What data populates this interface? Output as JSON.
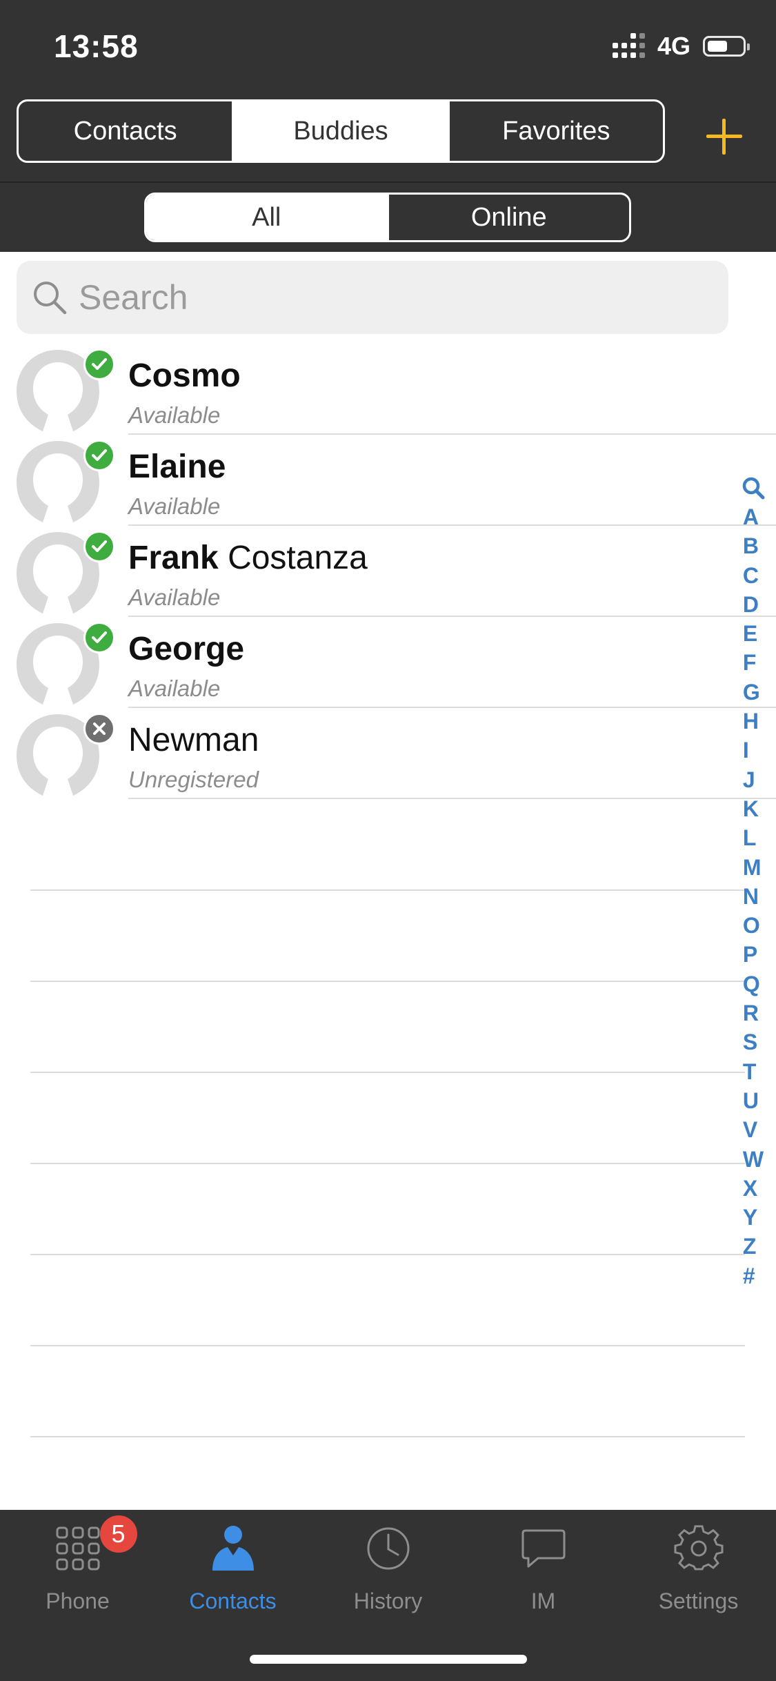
{
  "status_bar": {
    "time": "13:58",
    "network": "4G"
  },
  "top_segments": [
    "Contacts",
    "Buddies",
    "Favorites"
  ],
  "top_segments_active": "Buddies",
  "filter_segments": [
    "All",
    "Online"
  ],
  "filter_active": "All",
  "search": {
    "placeholder": "Search",
    "value": ""
  },
  "contacts": [
    {
      "first": "Cosmo",
      "last": "",
      "status": "Available"
    },
    {
      "first": "Elaine",
      "last": "",
      "status": "Available"
    },
    {
      "first": "Frank",
      "last": "Costanza",
      "status": "Available"
    },
    {
      "first": "George",
      "last": "",
      "status": "Available"
    },
    {
      "first": "Newman",
      "last": "",
      "status": "Unregistered"
    }
  ],
  "index_letters": [
    "A",
    "B",
    "C",
    "D",
    "E",
    "F",
    "G",
    "H",
    "I",
    "J",
    "K",
    "L",
    "M",
    "N",
    "O",
    "P",
    "Q",
    "R",
    "S",
    "T",
    "U",
    "V",
    "W",
    "X",
    "Y",
    "Z",
    "#"
  ],
  "tabs": [
    {
      "label": "Phone",
      "icon": "dialpad-icon",
      "badge": "5"
    },
    {
      "label": "Contacts",
      "icon": "person-icon"
    },
    {
      "label": "History",
      "icon": "clock-icon"
    },
    {
      "label": "IM",
      "icon": "chat-bubble-icon"
    },
    {
      "label": "Settings",
      "icon": "gear-icon"
    }
  ],
  "active_tab": "Contacts",
  "colors": {
    "header_bg": "#333333",
    "accent_add": "#f6b91f",
    "available": "#3fac3f",
    "unregistered": "#6f6f6f",
    "index_blue": "#3d7fc4",
    "tab_active": "#3e8ee5",
    "badge_red": "#e5473f"
  }
}
